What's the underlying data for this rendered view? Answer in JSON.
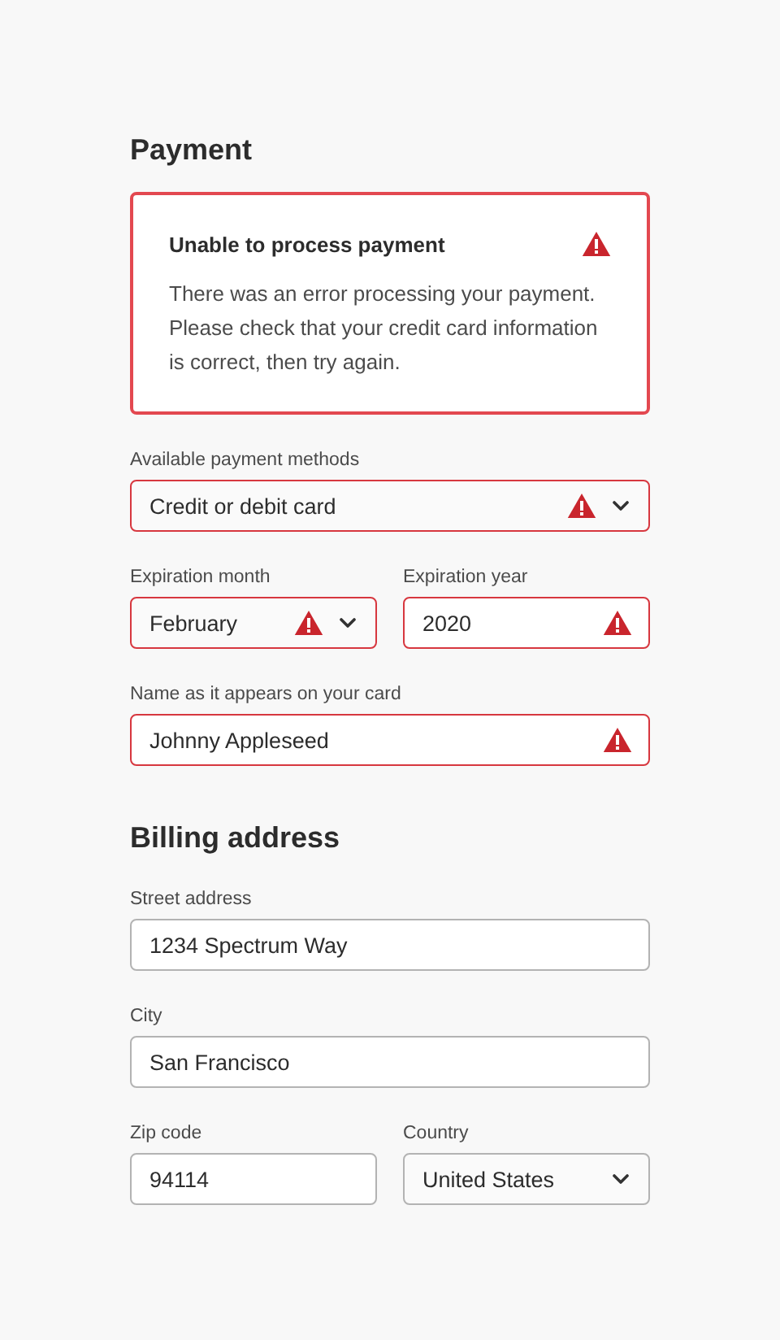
{
  "sections": [
    {
      "title": "Payment",
      "alert": {
        "kind": "error",
        "title": "Unable to process payment",
        "message": "There was an error processing your payment. Please check that your credit card information is correct, then try again."
      },
      "rows": [
        [
          {
            "label": "Available payment methods",
            "kind": "select",
            "value": "Credit or debit card",
            "invalid": true
          }
        ],
        [
          {
            "label": "Expiration month",
            "kind": "select",
            "value": "February",
            "invalid": true
          },
          {
            "label": "Expiration year",
            "kind": "text",
            "value": "2020",
            "invalid": true
          }
        ],
        [
          {
            "label": "Name as it appears on your card",
            "kind": "text",
            "value": "Johnny Appleseed",
            "invalid": true
          }
        ]
      ]
    },
    {
      "title": "Billing address",
      "rows": [
        [
          {
            "label": "Street address",
            "kind": "text",
            "value": "1234 Spectrum Way",
            "invalid": false
          }
        ],
        [
          {
            "label": "City",
            "kind": "text",
            "value": "San Francisco",
            "invalid": false
          }
        ],
        [
          {
            "label": "Zip code",
            "kind": "text",
            "value": "94114",
            "invalid": false
          },
          {
            "label": "Country",
            "kind": "select",
            "value": "United States",
            "invalid": false
          }
        ]
      ]
    }
  ]
}
